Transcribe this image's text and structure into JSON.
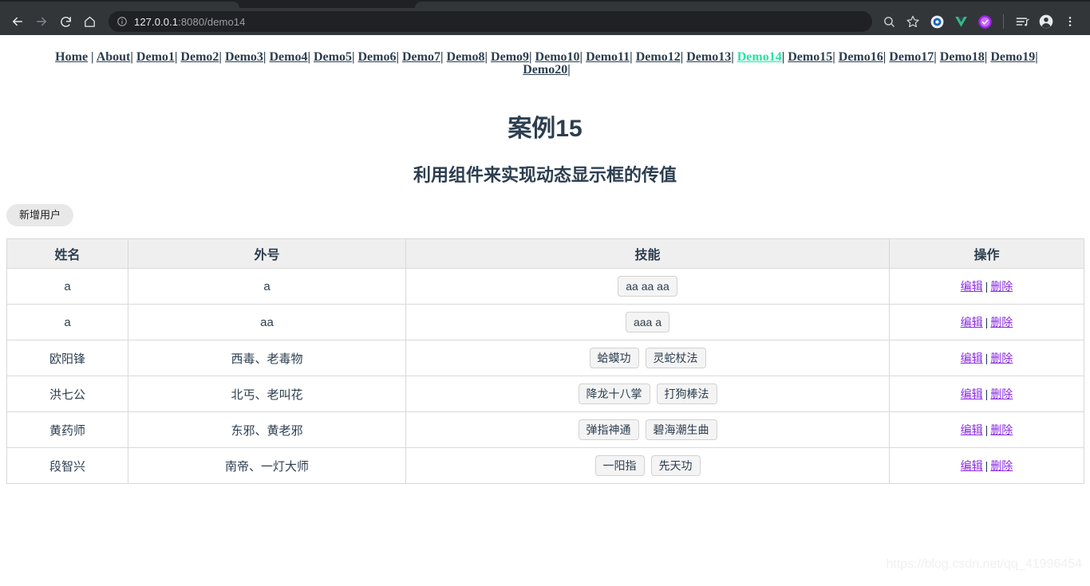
{
  "browser": {
    "back_icon": "back-arrow-icon",
    "forward_icon": "forward-arrow-icon",
    "reload_icon": "reload-icon",
    "home_icon": "home-icon",
    "info_icon": "page-info-icon",
    "url_host": "127.0.0.1",
    "url_rest": ":8080/demo14",
    "url_full": "127.0.0.1:8080/demo14",
    "right_icons": [
      {
        "name": "search-icon",
        "label": "Search"
      },
      {
        "name": "bookmark-star-icon",
        "label": "Bookmark this tab"
      },
      {
        "name": "extension-blue-circle-icon",
        "label": "Extension"
      },
      {
        "name": "vue-devtools-icon",
        "label": "Vue Devtools"
      },
      {
        "name": "purple-check-badge-icon",
        "label": "Extension"
      },
      {
        "name": "media-playlist-icon",
        "label": "Media"
      },
      {
        "name": "profile-avatar-icon",
        "label": "Profile"
      },
      {
        "name": "chrome-menu-icon",
        "label": "Customize and control"
      }
    ]
  },
  "nav": {
    "line1": [
      {
        "label": "Home",
        "active": false,
        "trailing": " | "
      },
      {
        "label": "About",
        "active": false,
        "trailing": "| "
      },
      {
        "label": "Demo1",
        "active": false,
        "trailing": "| "
      },
      {
        "label": "Demo2",
        "active": false,
        "trailing": "| "
      },
      {
        "label": "Demo3",
        "active": false,
        "trailing": "| "
      },
      {
        "label": "Demo4",
        "active": false,
        "trailing": "| "
      },
      {
        "label": "Demo5",
        "active": false,
        "trailing": "| "
      },
      {
        "label": "Demo6",
        "active": false,
        "trailing": "| "
      },
      {
        "label": "Demo7",
        "active": false,
        "trailing": "| "
      },
      {
        "label": "Demo8",
        "active": false,
        "trailing": "| "
      },
      {
        "label": "Demo9",
        "active": false,
        "trailing": "| "
      },
      {
        "label": "Demo10",
        "active": false,
        "trailing": "| "
      },
      {
        "label": "Demo11",
        "active": false,
        "trailing": "| "
      },
      {
        "label": "Demo12",
        "active": false,
        "trailing": "| "
      },
      {
        "label": "Demo13",
        "active": false,
        "trailing": "| "
      },
      {
        "label": "Demo14",
        "active": true,
        "trailing": "| "
      },
      {
        "label": "Demo15",
        "active": false,
        "trailing": "| "
      },
      {
        "label": "Demo16",
        "active": false,
        "trailing": "| "
      },
      {
        "label": "Demo17",
        "active": false,
        "trailing": "| "
      },
      {
        "label": "Demo18",
        "active": false,
        "trailing": "| "
      },
      {
        "label": "Demo19",
        "active": false,
        "trailing": "| "
      },
      {
        "label": "Demo20",
        "active": false,
        "trailing": "| "
      }
    ]
  },
  "headings": {
    "h1": "案例15",
    "h2": "利用组件来实现动态显示框的传值"
  },
  "toolbar": {
    "add_user_label": "新增用户"
  },
  "table": {
    "columns": [
      "姓名",
      "外号",
      "技能",
      "操作"
    ],
    "ops": {
      "edit": "编辑",
      "separator": "|",
      "delete": "删除"
    },
    "rows": [
      {
        "name": "a",
        "nickname": "a",
        "skills": [
          "aa aa aa"
        ]
      },
      {
        "name": "a",
        "nickname": "aa",
        "skills": [
          "aaa a"
        ]
      },
      {
        "name": "欧阳锋",
        "nickname": "西毒、老毒物",
        "skills": [
          "蛤蟆功",
          "灵蛇杖法"
        ]
      },
      {
        "name": "洪七公",
        "nickname": "北丐、老叫花",
        "skills": [
          "降龙十八掌",
          "打狗棒法"
        ]
      },
      {
        "name": "黄药师",
        "nickname": "东邪、黄老邪",
        "skills": [
          "弹指神通",
          "碧海潮生曲"
        ]
      },
      {
        "name": "段智兴",
        "nickname": "南帝、一灯大师",
        "skills": [
          "一阳指",
          "先天功"
        ]
      }
    ]
  },
  "watermark": "https://blog.csdn.net/qq_41996454",
  "colors": {
    "active_link": "#23e6a3",
    "heading": "#2c3e50",
    "op_link": "#8a2be2",
    "chrome_bg": "#323639",
    "omnibox_bg": "#202124",
    "table_header_bg": "#efefef",
    "table_border": "#d9d9d9",
    "tag_bg": "#f4f4f4"
  }
}
